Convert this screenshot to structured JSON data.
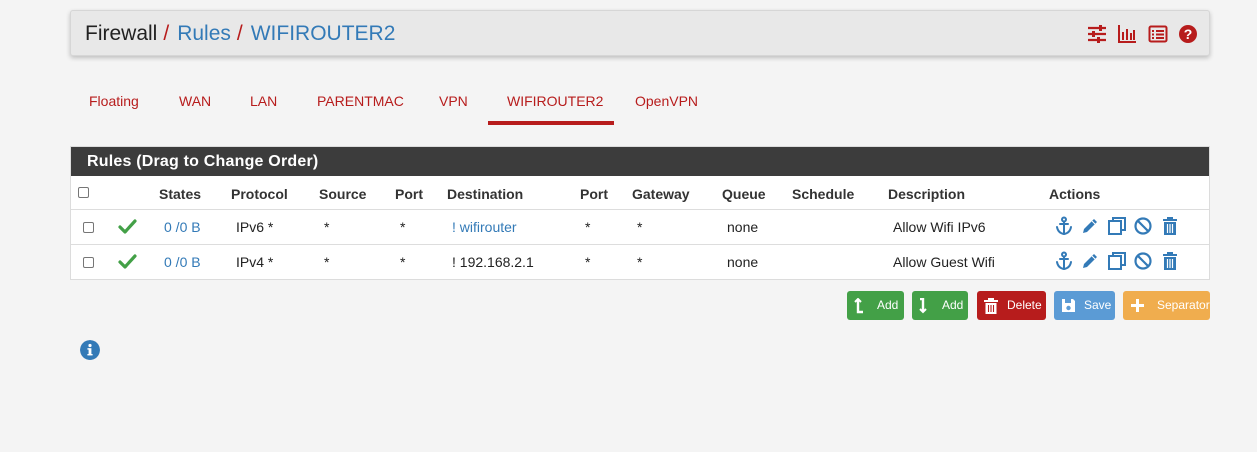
{
  "breadcrumb": {
    "root": "Firewall",
    "separator": "/",
    "rules": "Rules",
    "current": "WIFIROUTER2"
  },
  "header_icons": [
    "sliders-icon",
    "bar-chart-icon",
    "list-icon",
    "help-icon"
  ],
  "tabs": [
    {
      "label": "Floating",
      "active": false
    },
    {
      "label": "WAN",
      "active": false
    },
    {
      "label": "LAN",
      "active": false
    },
    {
      "label": "PARENTMAC",
      "active": false
    },
    {
      "label": "VPN",
      "active": false
    },
    {
      "label": "WIFIROUTER2",
      "active": true
    },
    {
      "label": "OpenVPN",
      "active": false
    }
  ],
  "panel": {
    "title": "Rules (Drag to Change Order)",
    "columns": {
      "states": "States",
      "protocol": "Protocol",
      "source": "Source",
      "port": "Port",
      "destination": "Destination",
      "port2": "Port",
      "gateway": "Gateway",
      "queue": "Queue",
      "schedule": "Schedule",
      "description": "Description",
      "actions": "Actions"
    },
    "rows": [
      {
        "status": "check-icon",
        "states": "0 /0 B",
        "protocol": "IPv6 *",
        "source": "*",
        "port": "*",
        "destination": "! wifirouter",
        "dest_port": "*",
        "gateway": "*",
        "queue": "none",
        "schedule": "",
        "description": "Allow Wifi IPv6"
      },
      {
        "status": "check-icon",
        "states": "0 /0 B",
        "protocol": "IPv4 *",
        "source": "*",
        "port": "*",
        "destination": "! 192.168.2.1",
        "dest_port": "*",
        "gateway": "*",
        "queue": "none",
        "schedule": "",
        "description": "Allow Guest Wifi"
      }
    ],
    "row_actions": [
      "anchor-icon",
      "pencil-icon",
      "copy-icon",
      "disable-icon",
      "trash-icon"
    ]
  },
  "buttons": {
    "add_top": "Add",
    "add_bottom": "Add",
    "delete": "Delete",
    "save": "Save",
    "separator": "Separator"
  },
  "colors": {
    "accent": "#b71c1c",
    "link": "#337ab7",
    "success": "#43a047",
    "danger": "#b71c1c",
    "save": "#5b9bd5",
    "separator": "#f0ad4e",
    "panel_heading": "#3c3c3c"
  }
}
